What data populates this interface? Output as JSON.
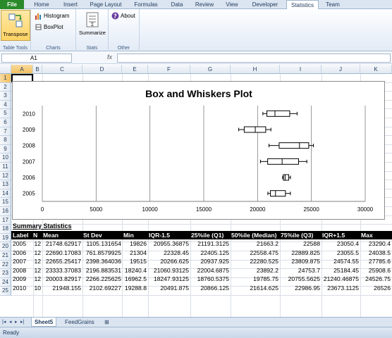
{
  "ribbon_tabs": [
    "File",
    "Home",
    "Insert",
    "Page Layout",
    "Formulas",
    "Data",
    "Review",
    "View",
    "Developer",
    "Statistics",
    "Team"
  ],
  "ribbon": {
    "table_tools": {
      "transpose": "Transpose",
      "label": "Table Tools"
    },
    "charts": {
      "histogram": "Histogram",
      "boxplot": "BoxPlot",
      "label": "Charts"
    },
    "stats": {
      "summarize": "Summarize",
      "label": "Stats"
    },
    "other": {
      "about": "About",
      "label": "Other"
    }
  },
  "formula_bar": {
    "name_box": "A1",
    "fx": "fx",
    "content": ""
  },
  "columns": [
    "A",
    "B",
    "C",
    "D",
    "E",
    "F",
    "G",
    "H",
    "I",
    "J",
    "K"
  ],
  "rows": [
    "1",
    "2",
    "3",
    "4",
    "5",
    "6",
    "7",
    "8",
    "9",
    "10",
    "11",
    "12",
    "13",
    "14",
    "15",
    "16",
    "17",
    "18",
    "19",
    "20",
    "21",
    "22",
    "23",
    "24",
    "25"
  ],
  "chart_data": {
    "type": "boxplot",
    "title": "Box and Whiskers Plot",
    "categories": [
      "2010",
      "2009",
      "2008",
      "2007",
      "2006",
      "2005"
    ],
    "xlim": [
      0,
      30000
    ],
    "xticks": [
      "0",
      "5000",
      "10000",
      "15000",
      "20000",
      "25000",
      "30000"
    ],
    "boxes": [
      {
        "label": "2010",
        "min": 20491.875,
        "q1": 20866.125,
        "median": 21614.625,
        "q3": 22986.95,
        "max": 23673.1125
      },
      {
        "label": "2009",
        "min": 18247.93125,
        "q1": 18760.5375,
        "median": 19785.75,
        "q3": 20755.5625,
        "max": 21240.46875
      },
      {
        "label": "2008",
        "min": 21060.93125,
        "q1": 22004.6875,
        "median": 23892.2,
        "q3": 24753.7,
        "max": 25184.45
      },
      {
        "label": "2007",
        "min": 20266.625,
        "q1": 20937.925,
        "median": 22280.525,
        "q3": 23809.875,
        "max": 24574.55
      },
      {
        "label": "2006",
        "min": 22328.45,
        "q1": 22405.125,
        "median": 22558.475,
        "q3": 22889.825,
        "max": 23055.5
      },
      {
        "label": "2005",
        "min": 20955.36875,
        "q1": 21191.3125,
        "median": 21663.2,
        "q3": 22588,
        "max": 23050.4
      }
    ]
  },
  "summary": {
    "title": "Summary Statistics",
    "headers": [
      "Label",
      "N",
      "Mean",
      "St Dev",
      "Min",
      "IQR-1.5",
      "25%ile (Q1)",
      "50%ile (Median)",
      "75%ile (Q3)",
      "IQR+1.5",
      "Max"
    ],
    "rows": [
      [
        "2005",
        "12",
        "21748.62917",
        "1105.131654",
        "19826",
        "20955.36875",
        "21191.3125",
        "21663.2",
        "22588",
        "23050.4",
        "23290.4"
      ],
      [
        "2006",
        "12",
        "22690.17083",
        "761.8579925",
        "21304",
        "22328.45",
        "22405.125",
        "22558.475",
        "22889.825",
        "23055.5",
        "24038.5"
      ],
      [
        "2007",
        "12",
        "22655.25417",
        "2398.364036",
        "19515",
        "20266.625",
        "20937.925",
        "22280.525",
        "23809.875",
        "24574.55",
        "27785.6"
      ],
      [
        "2008",
        "12",
        "23333.37083",
        "2196.883531",
        "18240.4",
        "21060.93125",
        "22004.6875",
        "23892.2",
        "24753.7",
        "25184.45",
        "25908.6"
      ],
      [
        "2009",
        "12",
        "20003.82917",
        "2266.225625",
        "16962.5",
        "18247.93125",
        "18760.5375",
        "19785.75",
        "20755.5625",
        "21240.46875",
        "24526.75"
      ],
      [
        "2010",
        "10",
        "21948.155",
        "2102.69227",
        "19288.8",
        "20491.875",
        "20866.125",
        "21614.625",
        "22986.95",
        "23673.1125",
        "26526"
      ]
    ]
  },
  "sheet_tabs": [
    "Sheet5",
    "FeedGrains"
  ],
  "status": "Ready"
}
